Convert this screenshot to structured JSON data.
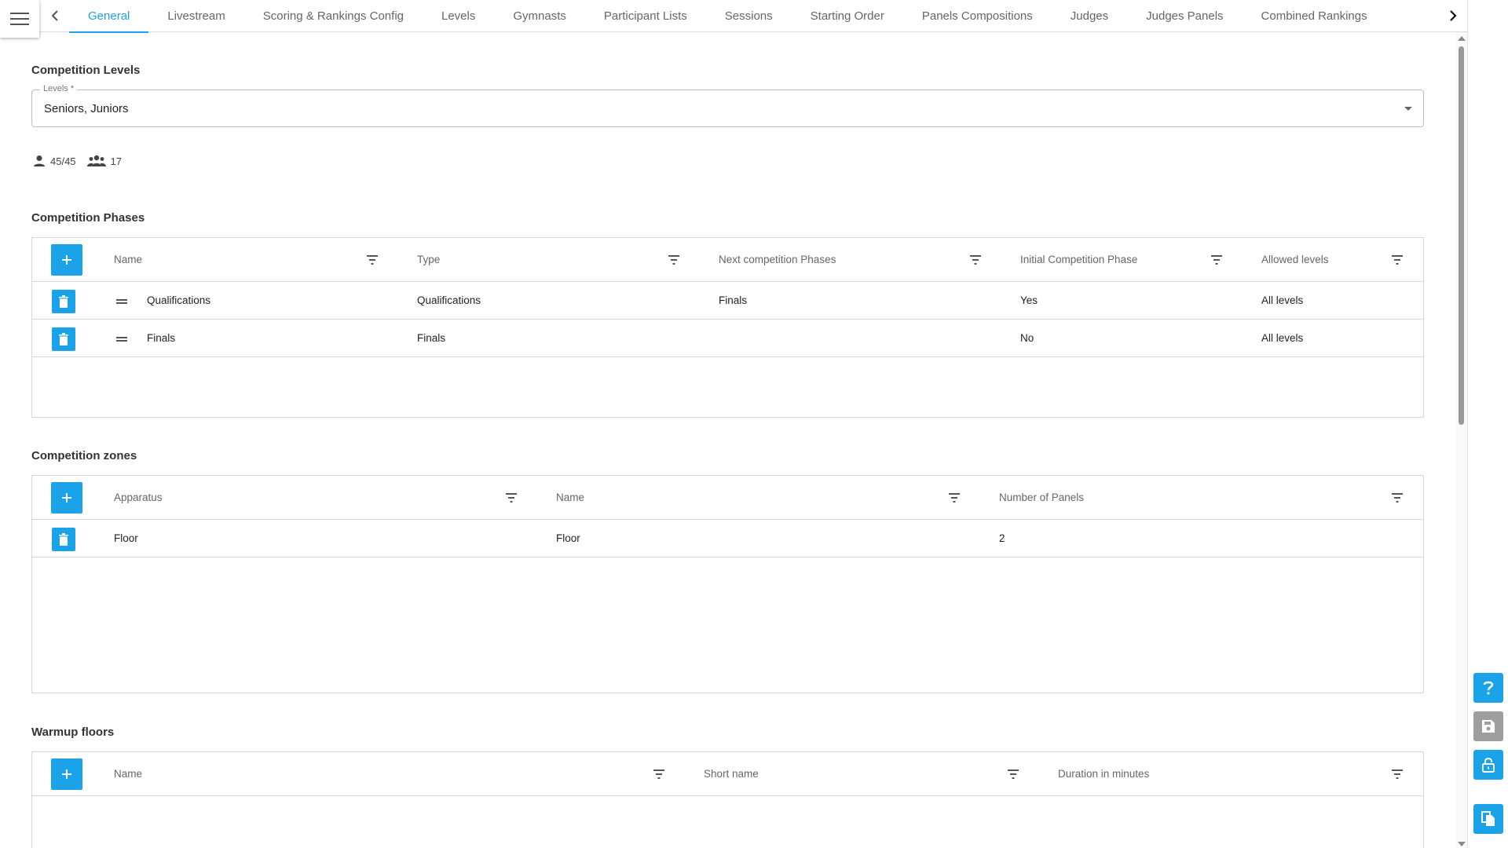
{
  "nav": {
    "prev_icon": "chevron-left-icon",
    "next_icon": "chevron-right-icon",
    "tabs": [
      {
        "label": "General"
      },
      {
        "label": "Livestream"
      },
      {
        "label": "Scoring & Rankings Config"
      },
      {
        "label": "Levels"
      },
      {
        "label": "Gymnasts"
      },
      {
        "label": "Participant Lists"
      },
      {
        "label": "Sessions"
      },
      {
        "label": "Starting Order"
      },
      {
        "label": "Panels Compositions"
      },
      {
        "label": "Judges"
      },
      {
        "label": "Judges Panels"
      },
      {
        "label": "Combined Rankings"
      }
    ],
    "active_tab": "General"
  },
  "competition_levels": {
    "title": "Competition Levels",
    "levels_label": "Levels *",
    "levels_value": "Seniors, Juniors",
    "gymnast_count": "45/45",
    "team_count": "17"
  },
  "competition_phases": {
    "title": "Competition Phases",
    "columns": [
      "Name",
      "Type",
      "Next competition Phases",
      "Initial Competition Phase",
      "Allowed levels"
    ],
    "rows": [
      [
        "Qualifications",
        "Qualifications",
        "Finals",
        "Yes",
        "All levels"
      ],
      [
        "Finals",
        "Finals",
        "",
        "No",
        "All levels"
      ]
    ]
  },
  "competition_zones": {
    "title": "Competition zones",
    "columns": [
      "Apparatus",
      "Name",
      "Number of Panels"
    ],
    "rows": [
      [
        "Floor",
        "Floor",
        "2"
      ]
    ]
  },
  "warmup_floors": {
    "title": "Warmup floors",
    "columns": [
      "Name",
      "Short name",
      "Duration in minutes"
    ],
    "rows": []
  },
  "side_actions": [
    {
      "icon": "help-icon"
    },
    {
      "icon": "save-icon"
    },
    {
      "icon": "unlock-icon"
    },
    {
      "icon": "copy-icon"
    }
  ],
  "colors": {
    "accent": "#1aa3e8",
    "disabled": "#9e9e9e"
  }
}
